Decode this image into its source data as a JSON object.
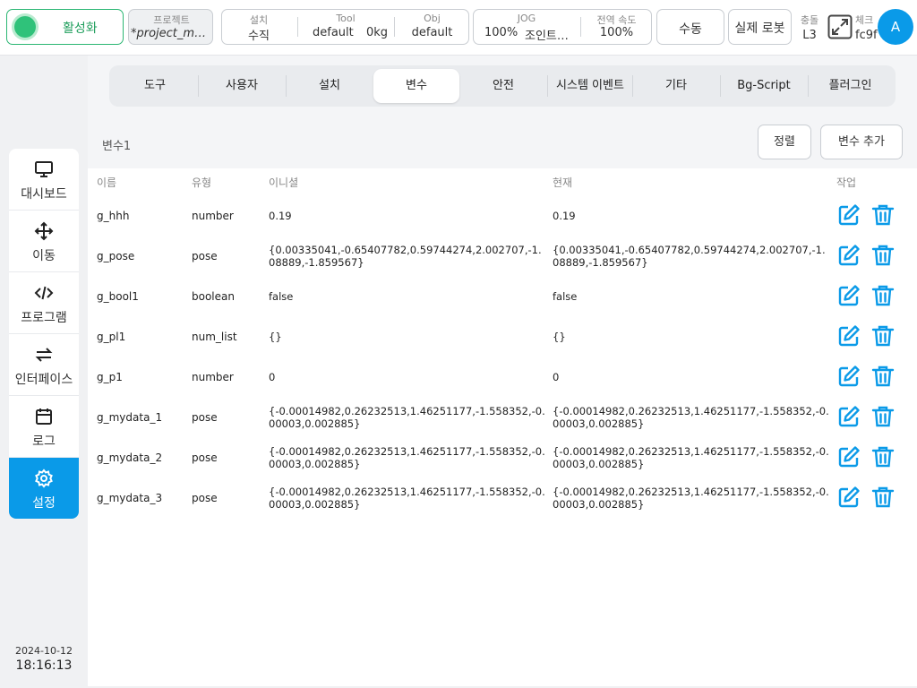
{
  "topbar": {
    "activate_label": "활성화",
    "project": {
      "title": "프로젝트",
      "value": "*project_mo…"
    },
    "install": {
      "setup_title": "설치",
      "setup_value": "수직",
      "tool_title": "Tool",
      "tool_value": "default",
      "tool_weight": "0kg",
      "obj_title": "Obj",
      "obj_value": "default"
    },
    "jog": {
      "jog_title": "JOG",
      "jog_value": "100%",
      "jog_mode": "조인트…",
      "speed_title": "전역 속도",
      "speed_value": "100%"
    },
    "manual_label": "수동",
    "real_robot_label": "실제 로봇",
    "collision": {
      "title": "충돌",
      "value": "L3"
    },
    "check": {
      "title": "체크",
      "value": "fc9f"
    },
    "avatar_letter": "A"
  },
  "sidebar": {
    "items": [
      {
        "label": "대시보드",
        "icon": "monitor-icon"
      },
      {
        "label": "이동",
        "icon": "move-icon"
      },
      {
        "label": "프로그램",
        "icon": "code-icon"
      },
      {
        "label": "인터페이스",
        "icon": "swap-icon"
      },
      {
        "label": "로그",
        "icon": "calendar-icon"
      },
      {
        "label": "설정",
        "icon": "gear-icon",
        "active": true
      }
    ],
    "date": "2024-10-12",
    "time": "18:16:13"
  },
  "tabs": [
    {
      "label": "도구"
    },
    {
      "label": "사용자"
    },
    {
      "label": "설치"
    },
    {
      "label": "변수",
      "active": true
    },
    {
      "label": "안전"
    },
    {
      "label": "시스템 이벤트"
    },
    {
      "label": "기타"
    },
    {
      "label": "Bg-Script"
    },
    {
      "label": "플러그인"
    }
  ],
  "panel": {
    "title": "변수1",
    "sort_label": "정렬",
    "add_label": "변수 추가"
  },
  "table": {
    "headers": {
      "name": "이름",
      "type": "유형",
      "initial": "이니셜",
      "current": "현재",
      "action": "작업"
    },
    "rows": [
      {
        "name": "g_hhh",
        "type": "number",
        "initial": "0.19",
        "current": "0.19"
      },
      {
        "name": "g_pose",
        "type": "pose",
        "initial": "{0.00335041,-0.65407782,0.59744274,2.002707,-1.08889,-1.859567}",
        "current": "{0.00335041,-0.65407782,0.59744274,2.002707,-1.08889,-1.859567}"
      },
      {
        "name": "g_bool1",
        "type": "boolean",
        "initial": "false",
        "current": "false"
      },
      {
        "name": "g_pl1",
        "type": "num_list",
        "initial": "{}",
        "current": "{}"
      },
      {
        "name": "g_p1",
        "type": "number",
        "initial": "0",
        "current": "0"
      },
      {
        "name": "g_mydata_1",
        "type": "pose",
        "initial": "{-0.00014982,0.26232513,1.46251177,-1.558352,-0.00003,0.002885}",
        "current": "{-0.00014982,0.26232513,1.46251177,-1.558352,-0.00003,0.002885}"
      },
      {
        "name": "g_mydata_2",
        "type": "pose",
        "initial": "{-0.00014982,0.26232513,1.46251177,-1.558352,-0.00003,0.002885}",
        "current": "{-0.00014982,0.26232513,1.46251177,-1.558352,-0.00003,0.002885}"
      },
      {
        "name": "g_mydata_3",
        "type": "pose",
        "initial": "{-0.00014982,0.26232513,1.46251177,-1.558352,-0.00003,0.002885}",
        "current": "{-0.00014982,0.26232513,1.46251177,-1.558352,-0.00003,0.002885}"
      }
    ]
  },
  "colors": {
    "accent": "#0a9ae8",
    "active_green": "#2fc27a"
  }
}
